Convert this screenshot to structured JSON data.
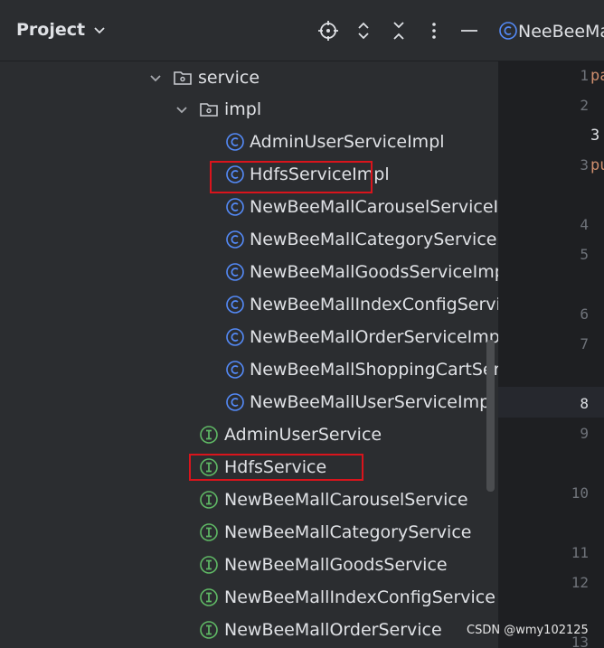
{
  "project_panel": {
    "title": "Project"
  },
  "tree": {
    "folders": [
      {
        "label": "service"
      },
      {
        "label": "impl"
      }
    ],
    "impl_classes": [
      "AdminUserServiceImpl",
      "HdfsServiceImpl",
      "NewBeeMallCarouselServiceIm",
      "NewBeeMallCategoryServiceI",
      "NewBeeMallGoodsServiceImp",
      "NewBeeMallIndexConfigServic",
      "NewBeeMallOrderServiceImpl",
      "NewBeeMallShoppingCartServ",
      "NewBeeMallUserServiceImpl"
    ],
    "interfaces": [
      "AdminUserService",
      "HdfsService",
      "NewBeeMallCarouselService",
      "NewBeeMallCategoryService",
      "NewBeeMallGoodsService",
      "NewBeeMallIndexConfigService",
      "NewBeeMallOrderService"
    ]
  },
  "editor": {
    "tab_label": "NeeBeeMa",
    "line_numbers": [
      "1",
      "2",
      "3",
      "4",
      "5",
      "6",
      "7",
      "8",
      "9",
      "10",
      "11",
      "12",
      "13"
    ],
    "active_line": "8",
    "code_fragments": [
      "pa",
      "3",
      "pu"
    ]
  },
  "colors": {
    "class_icon": "#548af7",
    "interface_icon": "#5fb865",
    "highlight_box": "#d9141c"
  },
  "watermark": "CSDN @wmy102125"
}
